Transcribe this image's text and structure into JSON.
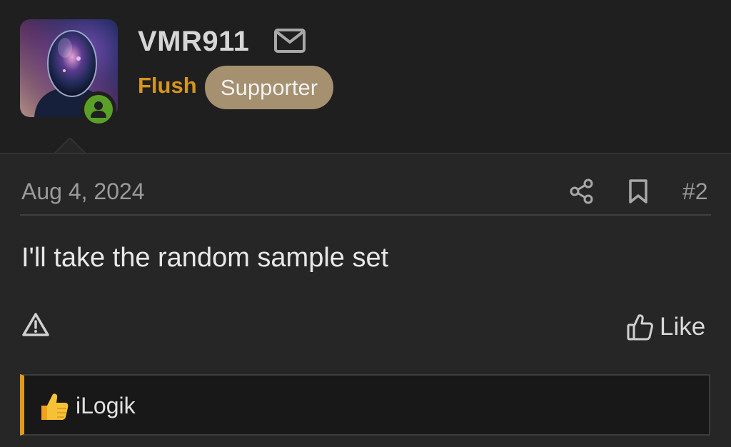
{
  "user": {
    "name": "VMR911",
    "title": "Flush",
    "badge": "Supporter",
    "online": true
  },
  "post": {
    "date": "Aug 4, 2024",
    "number": "#2",
    "body": "I'll take the random sample set"
  },
  "actions": {
    "like_label": "Like"
  },
  "reactions": {
    "user": "iLogik"
  },
  "icons": [
    "mail-icon",
    "share-icon",
    "bookmark-icon",
    "warning-icon",
    "thumbs-up-icon",
    "online-user-icon"
  ],
  "colors": {
    "title": "#d6951c",
    "badge": "#a5906f",
    "online": "#5aa028",
    "reaction_accent": "#e09a1f"
  }
}
